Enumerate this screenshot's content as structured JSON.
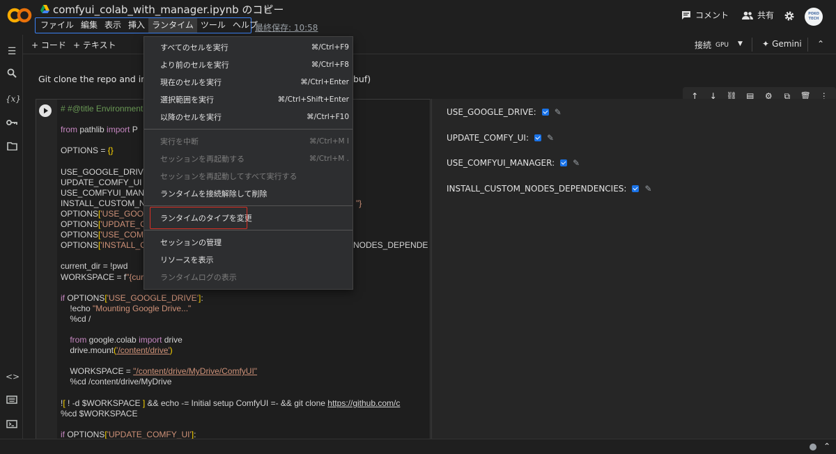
{
  "header": {
    "logo": "CO",
    "title": "comfyui_colab_with_manager.ipynb のコピー",
    "star_icon": "☆",
    "menus": [
      "ファイル",
      "編集",
      "表示",
      "挿入",
      "ランタイム",
      "ツール",
      "ヘルプ"
    ],
    "last_saved": "最終保存: 10:58",
    "comment_label": "コメント",
    "share_label": "共有",
    "avatar_text": "POKO TECH"
  },
  "toolbar": {
    "add_code": "+ コード",
    "add_text": "+ テキスト",
    "connect_label": "接続",
    "runtime_type": "GPU",
    "gemini_label": "Gemini"
  },
  "text_cell": {
    "visible_start": "Git clone the repo and insta",
    "visible_end": "buf)"
  },
  "code_lines": [
    "# #@title Environment",
    "",
    "from pathlib import P",
    "",
    "OPTIONS = {}",
    "",
    "USE_GOOGLE_DRIVE =",
    "UPDATE_COMFY_UI =",
    "USE_COMFYUI_MANAG",
    "INSTALL_CUSTOM_NO",
    "OPTIONS['USE_GOOGL",
    "OPTIONS['UPDATE_CO",
    "OPTIONS['USE_COMFY",
    "OPTIONS['INSTALL_CU",
    "",
    "current_dir = !pwd",
    "WORKSPACE = f\"{curr",
    "",
    "if OPTIONS['USE_GOOGLE_DRIVE']:",
    "    !echo \"Mounting Google Drive...\"",
    "    %cd /",
    "",
    "    from google.colab import drive",
    "    drive.mount('/content/drive')",
    "",
    "    WORKSPACE = \"/content/drive/MyDrive/ComfyUI\"",
    "    %cd /content/drive/MyDrive",
    "",
    "![ ! -d $WORKSPACE ] && echo -= Initial setup ComfyUI =- && git clone https://github.com/c",
    "%cd $WORKSPACE",
    "",
    "if OPTIONS['UPDATE_COMFY_UI']:"
  ],
  "code_overflow": {
    "line9_tail": "\"}",
    "line13_tail": "NODES_DEPENDENC"
  },
  "form_fields": [
    {
      "label": "USE_GOOGLE_DRIVE:",
      "checked": true
    },
    {
      "label": "UPDATE_COMFY_UI:",
      "checked": true
    },
    {
      "label": "USE_COMFYUI_MANAGER:",
      "checked": true
    },
    {
      "label": "INSTALL_CUSTOM_NODES_DEPENDENCIES:",
      "checked": true
    }
  ],
  "runtime_menu": {
    "items": [
      {
        "label": "すべてのセルを実行",
        "shortcut": "⌘/Ctrl+F9",
        "disabled": false
      },
      {
        "label": "より前のセルを実行",
        "shortcut": "⌘/Ctrl+F8",
        "disabled": false
      },
      {
        "label": "現在のセルを実行",
        "shortcut": "⌘/Ctrl+Enter",
        "disabled": false
      },
      {
        "label": "選択範囲を実行",
        "shortcut": "⌘/Ctrl+Shift+Enter",
        "disabled": false
      },
      {
        "label": "以降のセルを実行",
        "shortcut": "⌘/Ctrl+F10",
        "disabled": false
      },
      {
        "label": "実行を中断",
        "shortcut": "⌘/Ctrl+M I",
        "disabled": true
      },
      {
        "label": "セッションを再起動する",
        "shortcut": "⌘/Ctrl+M .",
        "disabled": true
      },
      {
        "label": "セッションを再起動してすべて実行する",
        "shortcut": "",
        "disabled": true
      },
      {
        "label": "ランタイムを接続解除して削除",
        "shortcut": "",
        "disabled": false
      },
      {
        "label": "ランタイムのタイプを変更",
        "shortcut": "",
        "disabled": false
      },
      {
        "label": "セッションの管理",
        "shortcut": "",
        "disabled": false
      },
      {
        "label": "リソースを表示",
        "shortcut": "",
        "disabled": false
      },
      {
        "label": "ランタイムログの表示",
        "shortcut": "",
        "disabled": true
      }
    ]
  },
  "colors": {
    "accent": "#1a73e8",
    "highlight_border": "#d93025",
    "logo_orange": "#f9ab00"
  }
}
